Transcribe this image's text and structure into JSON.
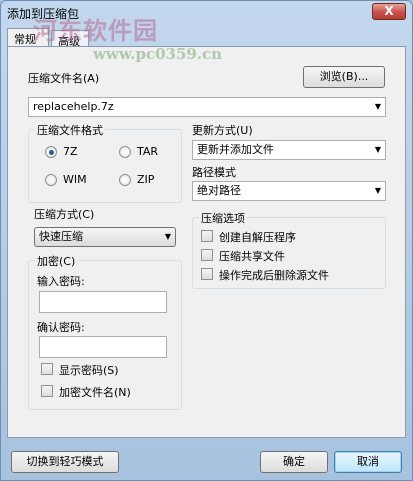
{
  "window": {
    "title": "添加到压缩包",
    "close_glyph": "X",
    "watermark_cn": "河东软件园",
    "watermark_url": "www.pc0359.cn"
  },
  "tabs": [
    {
      "label": "常规",
      "active": true
    },
    {
      "label": "高级",
      "active": false
    }
  ],
  "archive_name": {
    "label": "压缩文件名(A)",
    "value": "replacehelp.7z",
    "browse_label": "浏览(B)..."
  },
  "format": {
    "title": "压缩文件格式",
    "options": [
      {
        "label": "7Z",
        "selected": true
      },
      {
        "label": "TAR",
        "selected": false
      },
      {
        "label": "WIM",
        "selected": false
      },
      {
        "label": "ZIP",
        "selected": false
      }
    ]
  },
  "update": {
    "label": "更新方式(U)",
    "value": "更新并添加文件"
  },
  "path": {
    "label": "路径模式",
    "value": "绝对路径"
  },
  "method": {
    "label": "压缩方式(C)",
    "value": "快速压缩"
  },
  "options": {
    "title": "压缩选项",
    "items": [
      {
        "label": "创建自解压程序",
        "checked": false
      },
      {
        "label": "压缩共享文件",
        "checked": false
      },
      {
        "label": "操作完成后删除源文件",
        "checked": false
      }
    ]
  },
  "encryption": {
    "title": "加密(C)",
    "password_label": "输入密码:",
    "confirm_label": "确认密码:",
    "show_password_label": "显示密码(S)",
    "encrypt_names_label": "加密文件名(N)"
  },
  "footer": {
    "switch_label": "切换到轻巧模式",
    "ok_label": "确定",
    "cancel_label": "取消"
  },
  "icons": {
    "dropdown": "▼",
    "close": "close-icon"
  }
}
